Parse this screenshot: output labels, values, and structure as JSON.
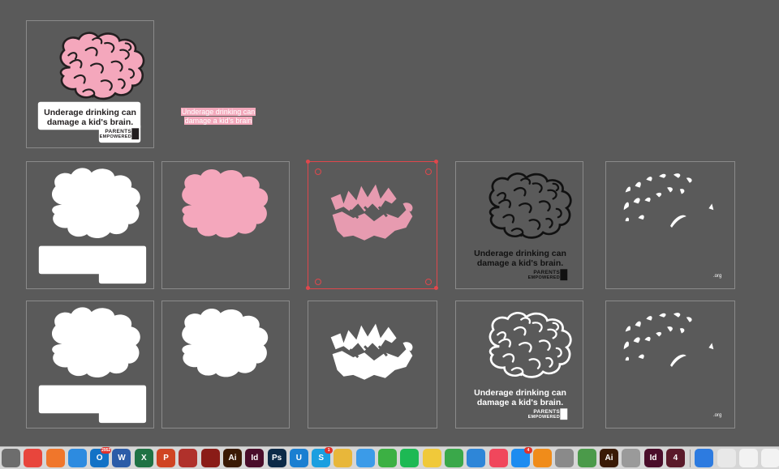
{
  "canvas": {
    "floating_text": [
      "Underage drinking can",
      "damage a kid's brain"
    ]
  },
  "poster": {
    "headline_line1": "Underage drinking can",
    "headline_line2": "damage a kid's brain.",
    "logo_line1": "PARENTS",
    "logo_line2": "EMPOWERED",
    "logo_org": ".org",
    "org_label": ".org"
  },
  "colors": {
    "brain_pink": "#f4a7bc",
    "brain_outline": "#231f20",
    "selection": "#e0474c",
    "background": "#5a5a5a"
  },
  "dock": {
    "items": [
      {
        "name": "launchpad-icon",
        "label": "",
        "color": "#6d6d6d"
      },
      {
        "name": "chrome-icon",
        "label": "",
        "color": "#e8453c"
      },
      {
        "name": "firefox-icon",
        "label": "",
        "color": "#f0762b"
      },
      {
        "name": "safari-icon",
        "label": "",
        "color": "#2d8be0"
      },
      {
        "name": "outlook-icon",
        "label": "O",
        "color": "#1272c6",
        "badge": "2952"
      },
      {
        "name": "word-icon",
        "label": "W",
        "color": "#2b5ca8"
      },
      {
        "name": "excel-icon",
        "label": "X",
        "color": "#1f7244"
      },
      {
        "name": "powerpoint-icon",
        "label": "P",
        "color": "#d04423"
      },
      {
        "name": "acrobat-reader-icon",
        "label": "",
        "color": "#b0312b"
      },
      {
        "name": "acrobat-icon",
        "label": "",
        "color": "#8a1c17"
      },
      {
        "name": "illustrator-icon",
        "label": "Ai",
        "color": "#3a1a05"
      },
      {
        "name": "indesign-icon",
        "label": "Id",
        "color": "#4a0d2a"
      },
      {
        "name": "photoshop-icon",
        "label": "Ps",
        "color": "#0c2a47"
      },
      {
        "name": "unity-icon",
        "label": "U",
        "color": "#1a7fd1"
      },
      {
        "name": "skype-icon",
        "label": "S",
        "color": "#1a9fe0",
        "badge": "1"
      },
      {
        "name": "photos-icon",
        "label": "",
        "color": "#e8b73a"
      },
      {
        "name": "messages-icon",
        "label": "",
        "color": "#3b9be8"
      },
      {
        "name": "facetime-icon",
        "label": "",
        "color": "#3cb043"
      },
      {
        "name": "spotify-icon",
        "label": "",
        "color": "#1db954"
      },
      {
        "name": "notes-icon",
        "label": "",
        "color": "#f0c93a"
      },
      {
        "name": "numbers-icon",
        "label": "",
        "color": "#3aa84a"
      },
      {
        "name": "keynote-icon",
        "label": "",
        "color": "#2e86d8"
      },
      {
        "name": "music-icon",
        "label": "",
        "color": "#f0475c"
      },
      {
        "name": "app-store-icon",
        "label": "",
        "color": "#1d8cf0",
        "badge": "4"
      },
      {
        "name": "vlc-icon",
        "label": "",
        "color": "#f08c1a"
      },
      {
        "name": "system-preferences-icon",
        "label": "",
        "color": "#8a8a8a"
      },
      {
        "name": "preview-icon",
        "label": "",
        "color": "#4b9a4a"
      },
      {
        "name": "illustrator-alt-icon",
        "label": "Ai",
        "color": "#3a1a05"
      },
      {
        "name": "printer-icon",
        "label": "",
        "color": "#9a9a9a"
      },
      {
        "name": "indesign-alt-icon",
        "label": "Id",
        "color": "#4a0d2a"
      },
      {
        "name": "app-4-icon",
        "label": "4",
        "color": "#5a1a2a"
      },
      {
        "name": "sep",
        "label": "",
        "color": ""
      },
      {
        "name": "globe-icon",
        "label": "",
        "color": "#2d7be0"
      },
      {
        "name": "document-icon",
        "label": "",
        "color": "#e8e8e8"
      },
      {
        "name": "window-thumbnail-icon",
        "label": "",
        "color": "#f2f2f2"
      },
      {
        "name": "window-thumbnail-2-icon",
        "label": "",
        "color": "#f2f2f2"
      },
      {
        "name": "trash-icon",
        "label": "",
        "color": "#c8c8c8"
      }
    ]
  }
}
